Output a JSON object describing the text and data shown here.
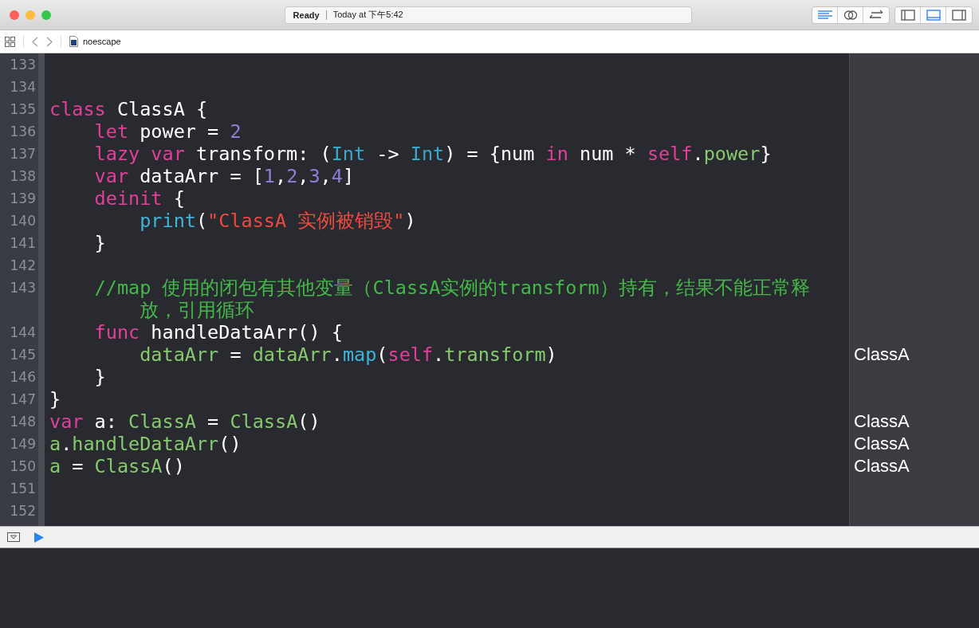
{
  "window": {
    "status": "Ready",
    "time": "Today at 下午5:42"
  },
  "jump_bar": {
    "file": "noescape"
  },
  "editor": {
    "lines": [
      {
        "number": "133"
      },
      {
        "number": "134"
      },
      {
        "number": "135",
        "tokens": [
          {
            "kind": "keyword",
            "text": "class"
          },
          {
            "kind": "plain",
            "text": " ClassA {"
          }
        ]
      },
      {
        "number": "136",
        "tokens": [
          {
            "kind": "keyword",
            "text": "    let"
          },
          {
            "kind": "plain",
            "text": " power = "
          },
          {
            "kind": "number",
            "text": "2"
          }
        ]
      },
      {
        "number": "137",
        "tokens": [
          {
            "kind": "keyword",
            "text": "    lazy var"
          },
          {
            "kind": "plain",
            "text": " transform: ("
          },
          {
            "kind": "type",
            "text": "Int"
          },
          {
            "kind": "plain",
            "text": " -> "
          },
          {
            "kind": "type",
            "text": "Int"
          },
          {
            "kind": "plain",
            "text": ") = {num "
          },
          {
            "kind": "keyword",
            "text": "in"
          },
          {
            "kind": "plain",
            "text": " num * "
          },
          {
            "kind": "keyword",
            "text": "self"
          },
          {
            "kind": "plain",
            "text": "."
          },
          {
            "kind": "member",
            "text": "power"
          },
          {
            "kind": "plain",
            "text": "}"
          }
        ]
      },
      {
        "number": "138",
        "tokens": [
          {
            "kind": "keyword",
            "text": "    var"
          },
          {
            "kind": "plain",
            "text": " dataArr = ["
          },
          {
            "kind": "number",
            "text": "1"
          },
          {
            "kind": "plain",
            "text": ","
          },
          {
            "kind": "number",
            "text": "2"
          },
          {
            "kind": "plain",
            "text": ","
          },
          {
            "kind": "number",
            "text": "3"
          },
          {
            "kind": "plain",
            "text": ","
          },
          {
            "kind": "number",
            "text": "4"
          },
          {
            "kind": "plain",
            "text": "]"
          }
        ]
      },
      {
        "number": "139",
        "tokens": [
          {
            "kind": "keyword",
            "text": "    deinit"
          },
          {
            "kind": "plain",
            "text": " {"
          }
        ]
      },
      {
        "number": "140",
        "tokens": [
          {
            "kind": "function",
            "text": "        print"
          },
          {
            "kind": "plain",
            "text": "("
          },
          {
            "kind": "string",
            "text": "\"ClassA 实例被销毁\""
          },
          {
            "kind": "plain",
            "text": ")"
          }
        ]
      },
      {
        "number": "141",
        "tokens": [
          {
            "kind": "plain",
            "text": "    }"
          }
        ]
      },
      {
        "number": "142"
      },
      {
        "number": "143",
        "tokens": [
          {
            "kind": "comment",
            "text": "    //map 使用的闭包有其他变量（ClassA实例的transform）持有，结果不能正常释"
          }
        ],
        "continuation": [
          {
            "kind": "comment",
            "text": "        放，引用循环"
          }
        ]
      },
      {
        "number": "144",
        "tokens": [
          {
            "kind": "keyword",
            "text": "    func"
          },
          {
            "kind": "plain",
            "text": " handleDataArr() {"
          }
        ]
      },
      {
        "number": "145",
        "tokens": [
          {
            "kind": "member",
            "text": "        dataArr"
          },
          {
            "kind": "plain",
            "text": " = "
          },
          {
            "kind": "member",
            "text": "dataArr"
          },
          {
            "kind": "plain",
            "text": "."
          },
          {
            "kind": "function",
            "text": "map"
          },
          {
            "kind": "plain",
            "text": "("
          },
          {
            "kind": "keyword",
            "text": "self"
          },
          {
            "kind": "plain",
            "text": "."
          },
          {
            "kind": "member",
            "text": "transform"
          },
          {
            "kind": "plain",
            "text": ")"
          }
        ],
        "result": "ClassA"
      },
      {
        "number": "146",
        "tokens": [
          {
            "kind": "plain",
            "text": "    }"
          }
        ]
      },
      {
        "number": "147",
        "tokens": [
          {
            "kind": "plain",
            "text": "}"
          }
        ]
      },
      {
        "number": "148",
        "tokens": [
          {
            "kind": "keyword",
            "text": "var"
          },
          {
            "kind": "plain",
            "text": " a: "
          },
          {
            "kind": "member",
            "text": "ClassA"
          },
          {
            "kind": "plain",
            "text": " = "
          },
          {
            "kind": "member",
            "text": "ClassA"
          },
          {
            "kind": "plain",
            "text": "()"
          }
        ],
        "result": "ClassA"
      },
      {
        "number": "149",
        "tokens": [
          {
            "kind": "member",
            "text": "a"
          },
          {
            "kind": "plain",
            "text": "."
          },
          {
            "kind": "member",
            "text": "handleDataArr"
          },
          {
            "kind": "plain",
            "text": "()"
          }
        ],
        "result": "ClassA"
      },
      {
        "number": "150",
        "tokens": [
          {
            "kind": "member",
            "text": "a"
          },
          {
            "kind": "plain",
            "text": " = "
          },
          {
            "kind": "member",
            "text": "ClassA"
          },
          {
            "kind": "plain",
            "text": "()"
          }
        ],
        "result": "ClassA"
      },
      {
        "number": "151"
      },
      {
        "number": "152"
      }
    ]
  }
}
